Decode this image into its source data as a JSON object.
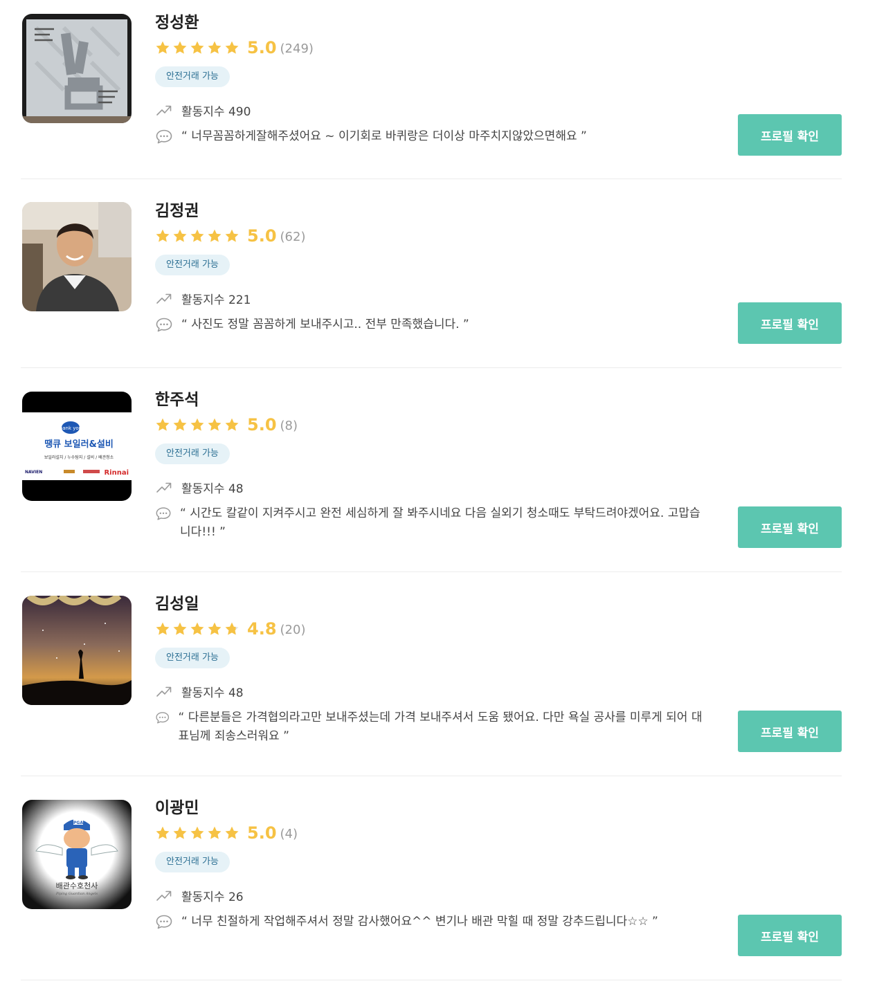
{
  "badge_label": "안전거래 가능",
  "button_label": "프로필 확인",
  "activity_prefix": "활동지수",
  "colors": {
    "star": "#f6c244",
    "star_empty": "#e2e2e2",
    "button": "#5cc6b0",
    "badge_bg": "#e6f2f7",
    "badge_text": "#2a6e92"
  },
  "experts": [
    {
      "name": "정성환",
      "score": "5.0",
      "rating": 5.0,
      "review_count": "(249)",
      "activity": "활동지수 490",
      "review": "“ 너무꼼꼼하게잘해주셨어요 ~ 이기회로 바퀴랑은 더이상 마주치지않았으면해요 ”",
      "avatar": "framed-calligraphy-photo"
    },
    {
      "name": "김정권",
      "score": "5.0",
      "rating": 5.0,
      "review_count": "(62)",
      "activity": "활동지수 221",
      "review": "“ 사진도 정말 꼼꼼하게 보내주시고.. 전부 만족했습니다. ”",
      "avatar": "portrait-photo"
    },
    {
      "name": "한주석",
      "score": "5.0",
      "rating": 5.0,
      "review_count": "(8)",
      "activity": "활동지수 48",
      "review": "“ 시간도 칼같이 지켜주시고 완전 세심하게 잘 봐주시네요 다음 실외기 청소때도 부탁드려야겠어요. 고맙습니다!!! ”",
      "avatar": "boiler-company-logo",
      "logo_text": {
        "bubble": "thank you!",
        "title": "땡큐 보일러&설비",
        "sub": "보일러설치 / 누수탐지 / 설비 / 배관청소",
        "brand_left": "NAVIEN",
        "brand_right": "Rinnai"
      }
    },
    {
      "name": "김성일",
      "score": "4.8",
      "rating": 4.8,
      "review_count": "(20)",
      "activity": "활동지수 48",
      "review": "“ 다른분들은 가격협의라고만 보내주셨는데 가격 보내주셔서 도움 됐어요. 다만 욕실 공사를 미루게 되어 대표님께 죄송스러워요 ”",
      "avatar": "night-sky-silhouette-photo"
    },
    {
      "name": "이광민",
      "score": "5.0",
      "rating": 5.0,
      "review_count": "(4)",
      "activity": "활동지수 26",
      "review": "“ 너무 친절하게 작업해주셔서 정말 감사했어요^^ 변기나 배관 막힐 때 정말 강추드립니다☆☆ ”",
      "avatar": "plumber-angel-mascot",
      "logo_text": {
        "cap": "PGA",
        "title": "배관수호천사",
        "sub": "Piping Guardian Angels"
      }
    }
  ]
}
